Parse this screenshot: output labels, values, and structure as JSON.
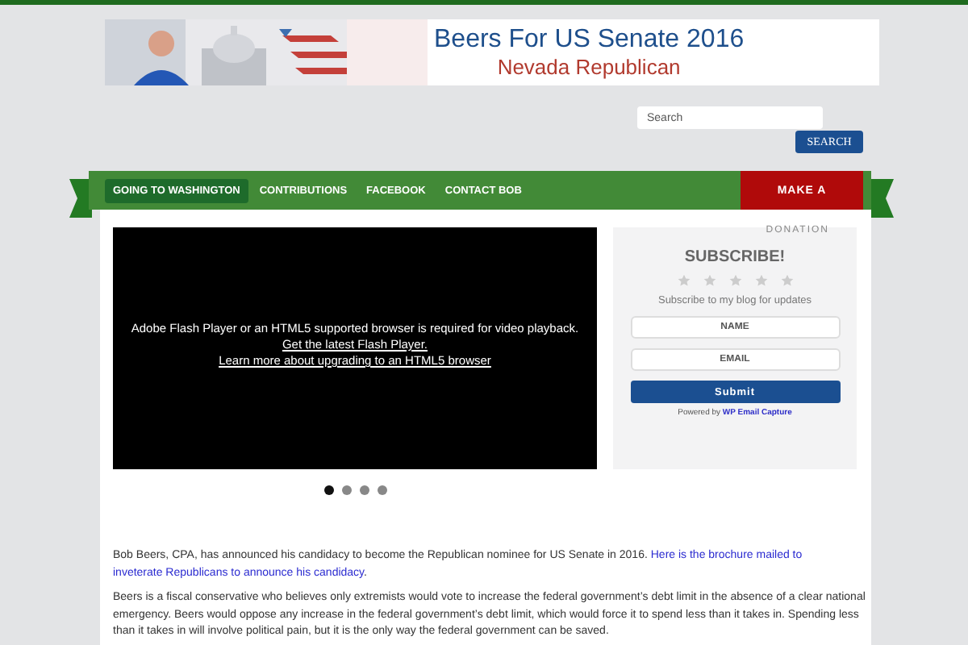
{
  "banner": {
    "title": "Beers For US Senate 2016",
    "subtitle": "Nevada Republican"
  },
  "search": {
    "placeholder": "Search",
    "button": "SEARCH"
  },
  "nav": {
    "items": [
      {
        "label": "GOING TO WASHINGTON",
        "selected": true
      },
      {
        "label": "CONTRIBUTIONS",
        "selected": false
      },
      {
        "label": "FACEBOOK",
        "selected": false
      },
      {
        "label": "CONTACT BOB",
        "selected": false
      }
    ],
    "donate": "MAKE A",
    "donate_overflow": "DONATION"
  },
  "video": {
    "message": "Adobe Flash Player or an HTML5 supported browser is required for video playback.",
    "links": [
      "Get the latest Flash Player.",
      "Learn more about upgrading to an HTML5 browser"
    ]
  },
  "slider_dots": [
    {
      "selected": true
    },
    {
      "selected": false
    },
    {
      "selected": false
    },
    {
      "selected": false
    }
  ],
  "subscribe": {
    "title": "SUBSCRIBE!",
    "stars": 0,
    "text": "Subscribe to my blog for updates",
    "fields": [
      {
        "placeholder": "NAME"
      },
      {
        "placeholder": "EMAIL"
      }
    ],
    "button": "Submit",
    "powered_by": "Powered by",
    "powered_link": "WP Email Capture"
  },
  "paragraphs": [
    {
      "text": "Bob Beers, CPA, has announced his candidacy to become the Republican nominee for US Senate in 2016.",
      "links": [
        "Here is the brochure mailed to",
        "inveterate Republicans to announce his candidacy"
      ],
      "after": "."
    },
    {
      "text": "Beers is a fiscal conservative who believes only extremists would vote to increase the federal government’s debt limit in the absence of a clear national emergency. Beers would oppose any increase in the federal government’s debt limit, which would force it to spend less than it takes in. Spending less than it takes in will involve political pain, but it is the only way the federal government can be saved."
    }
  ]
}
